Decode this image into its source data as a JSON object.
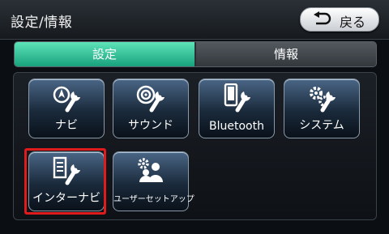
{
  "header": {
    "title": "設定/情報",
    "back_label": "戻る"
  },
  "tabs": [
    {
      "label": "設定",
      "active": true
    },
    {
      "label": "情報",
      "active": false
    }
  ],
  "tiles": [
    {
      "label": "ナビ",
      "icon": "navi-wrench-icon"
    },
    {
      "label": "サウンド",
      "icon": "speaker-wrench-icon"
    },
    {
      "label": "Bluetooth",
      "icon": "phone-wrench-icon"
    },
    {
      "label": "システム",
      "icon": "gears-icon"
    },
    {
      "label": "インターナビ",
      "icon": "internavi-wrench-icon",
      "selected": true
    },
    {
      "label": "ユーザーセットアップ",
      "icon": "users-gear-icon"
    }
  ],
  "colors": {
    "accent": "#2fc79a",
    "selection": "#e01b1b"
  }
}
